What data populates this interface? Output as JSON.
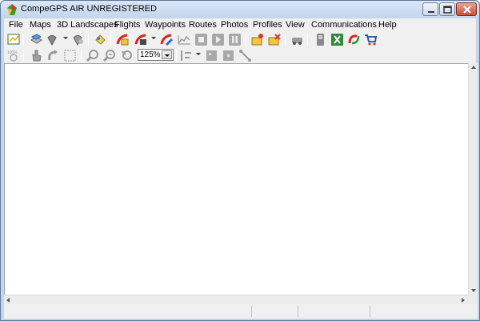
{
  "window": {
    "title": "CompeGPS AIR UNREGISTERED"
  },
  "menu": {
    "items": [
      "File",
      "Maps",
      "3D Landscapes",
      "Flights",
      "Waypoints",
      "Routes",
      "Photos",
      "Profiles",
      "View",
      "Communications",
      "Help"
    ]
  },
  "toolbar": {
    "zoom_value": "125%",
    "icons_row1": [
      "open-track-icon",
      "map-layers-icon",
      "waypoint-pin-icon",
      "route-pin-icon",
      "map-pan-icon",
      "flight-open-icon",
      "flight-save-icon",
      "flight-edit-icon",
      "profile-graph-icon",
      "stop-icon",
      "play-icon",
      "pause-icon",
      "photo-add-icon",
      "photo-link-icon",
      "car-icon",
      "phone-device-icon",
      "excel-export-icon",
      "sync-icon",
      "shop-cart-icon"
    ],
    "icons_row2": [
      "zoom-100-icon",
      "hand-tool-icon",
      "rotate-tool-icon",
      "select-tool-icon",
      "zoom-in-icon",
      "zoom-out-icon",
      "zoom-reset-icon",
      "align-tool-icon",
      "grid-tool-icon",
      "center-tool-icon",
      "measure-tool-icon"
    ]
  },
  "colors": {
    "title_bg": "#c6d6ea",
    "menu_bg": "#f0f0f0",
    "close_red": "#c74d36"
  }
}
